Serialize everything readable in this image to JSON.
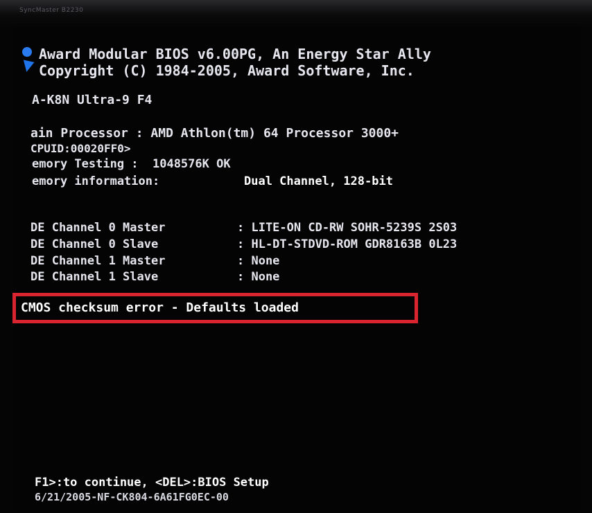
{
  "bezel": {
    "model_label": "SyncMaster B2230"
  },
  "header": {
    "line1": "Award Modular BIOS v6.00PG, An Energy Star Ally",
    "line2": "Copyright (C) 1984-2005, Award Software, Inc."
  },
  "board": {
    "model": "A-K8N Ultra-9 F4"
  },
  "processor": {
    "line": "ain Processor : AMD Athlon(tm) 64 Processor 3000+",
    "cpuid": "CPUID:00020FF0>"
  },
  "memory": {
    "testing": "emory Testing :  1048576K OK",
    "info_label": "emory information:",
    "info_value": "Dual Channel, 128-bit"
  },
  "ide": {
    "items": [
      {
        "label": "DE Channel 0 Master",
        "value": ": LITE-ON CD-RW SOHR-5239S 2S03"
      },
      {
        "label": "DE Channel 0 Slave ",
        "value": ": HL-DT-STDVD-ROM GDR8163B 0L23"
      },
      {
        "label": "DE Channel 1 Master",
        "value": ": None"
      },
      {
        "label": "DE Channel 1 Slave ",
        "value": ": None"
      }
    ]
  },
  "error": {
    "message": "CMOS checksum error - Defaults loaded",
    "highlight_color": "#d8252f"
  },
  "footer": {
    "prompt": "F1>:to continue, <DEL>:BIOS Setup",
    "bios_id": "6/21/2005-NF-CK804-6A61FG0EC-00"
  },
  "colors": {
    "screen_bg": "#040405",
    "text": "#e6e6ee",
    "logo_blue": "#2a7bf0"
  }
}
